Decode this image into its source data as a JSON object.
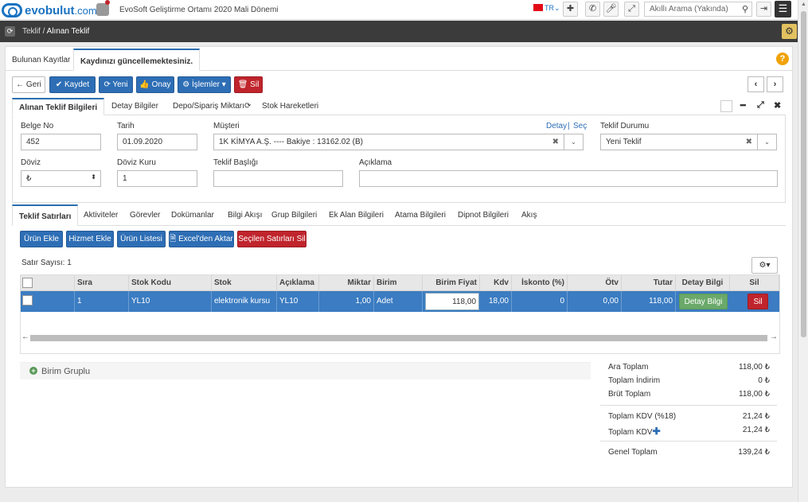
{
  "topbar": {
    "logo_main": "evobulut",
    "logo_com": ".com",
    "company": "EvoSoft Geliştirme Ortamı 2020 Mali Dönemi",
    "lang": "TR",
    "search_placeholder": "Akıllı Arama (Yakında)"
  },
  "breadcrumb": {
    "root": "Teklif",
    "sep": "/",
    "current": "Alınan Teklif"
  },
  "page_tabs": [
    "Bulunan Kayıtlar",
    "Kaydınızı güncellemektesiniz."
  ],
  "help": "?",
  "toolbar": {
    "back": "← Geri",
    "save": "✔ Kaydet",
    "new": "⟳ Yeni",
    "approve": "👍 Onay",
    "actions": "⚙ İşlemler ▾",
    "delete": "🗑 Sil",
    "prev": "‹",
    "next": "›"
  },
  "form_tabs": [
    "Alınan Teklif Bilgileri",
    "Detay Bilgiler",
    "Depo/Sipariş Miktarı",
    "Stok Hareketleri"
  ],
  "form": {
    "belge_no_label": "Belge No",
    "belge_no": "452",
    "tarih_label": "Tarih",
    "tarih": "01.09.2020",
    "musteri_label": "Müşteri",
    "musteri": "1K KİMYA A.Ş.  ---- Bakiye :       13162.02 (B)",
    "detay_link": "Detay",
    "link_sep": "|",
    "sec_link": "Seç",
    "durum_label": "Teklif Durumu",
    "durum": "Yeni Teklif",
    "doviz_label": "Döviz",
    "doviz": "₺",
    "doviz_kuru_label": "Döviz Kuru",
    "doviz_kuru": "1",
    "baslik_label": "Teklif Başlığı",
    "baslik": "",
    "aciklama_label": "Açıklama",
    "aciklama": ""
  },
  "bottom_tabs": [
    "Teklif Satırları",
    "Aktiviteler",
    "Görevler",
    "Dokümanlar",
    "Bilgi Akışı",
    "Grup Bilgileri",
    "Ek Alan Bilgileri",
    "Atama Bilgileri",
    "Dipnot Bilgileri",
    "Akış"
  ],
  "line_buttons": {
    "add_product": "Ürün Ekle",
    "add_service": "Hizmet Ekle",
    "product_list": "Ürün Listesi",
    "excel": "🗎 Excel'den Aktar",
    "delete_selected": "Seçilen Satırları Sil"
  },
  "row_count": "Satır Sayısı: 1",
  "grid": {
    "columns": [
      "Sıra",
      "Stok Kodu",
      "Stok",
      "Açıklama",
      "Miktar",
      "Birim",
      "Birim Fiyat",
      "Kdv",
      "İskonto (%)",
      "Ötv",
      "Tutar",
      "Detay Bilgi",
      "Sil"
    ],
    "row": {
      "sira": "1",
      "stok_kodu": "YL10",
      "stok": "elektronik kursu",
      "aciklama": "YL10",
      "miktar": "1,00",
      "birim": "Adet",
      "birim_fiyat": "118,00",
      "kdv": "18,00",
      "iskonto": "0",
      "otv": "0,00",
      "tutar": "118,00",
      "detay_btn": "Detay Bilgi",
      "sil_btn": "Sil"
    }
  },
  "unit_group": "Birim Gruplu",
  "totals": {
    "ara_toplam_label": "Ara Toplam",
    "ara_toplam": "118,00 ₺",
    "indirim_label": "Toplam İndirim",
    "indirim": "0 ₺",
    "brut_label": "Brüt Toplam",
    "brut": "118,00 ₺",
    "kdv18_label": "Toplam KDV (%18)",
    "kdv18": "21,24 ₺",
    "kdv_label": "Toplam KDV",
    "kdv": "21,24 ₺",
    "genel_label": "Genel Toplam",
    "genel": "139,24 ₺"
  }
}
